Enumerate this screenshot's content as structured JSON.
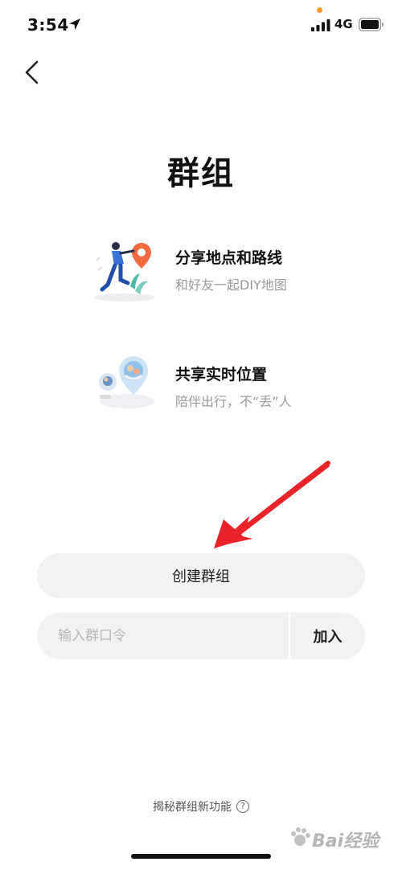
{
  "status_bar": {
    "time": "3:54",
    "network": "4G"
  },
  "page": {
    "title": "群组"
  },
  "features": [
    {
      "title": "分享地点和路线",
      "description": "和好友一起DIY地图"
    },
    {
      "title": "共享实时位置",
      "description": "陪伴出行，不“丢”人"
    }
  ],
  "actions": {
    "create_label": "创建群组",
    "code_placeholder": "输入群口令",
    "join_label": "加入"
  },
  "footer": {
    "link_text": "揭秘群组新功能",
    "help_glyph": "?"
  },
  "watermark": {
    "text": "Bai经验"
  },
  "colors": {
    "accent_orange": "#f26a3d",
    "button_bg": "#f2f2f2",
    "annotation_red": "#e8232a"
  }
}
